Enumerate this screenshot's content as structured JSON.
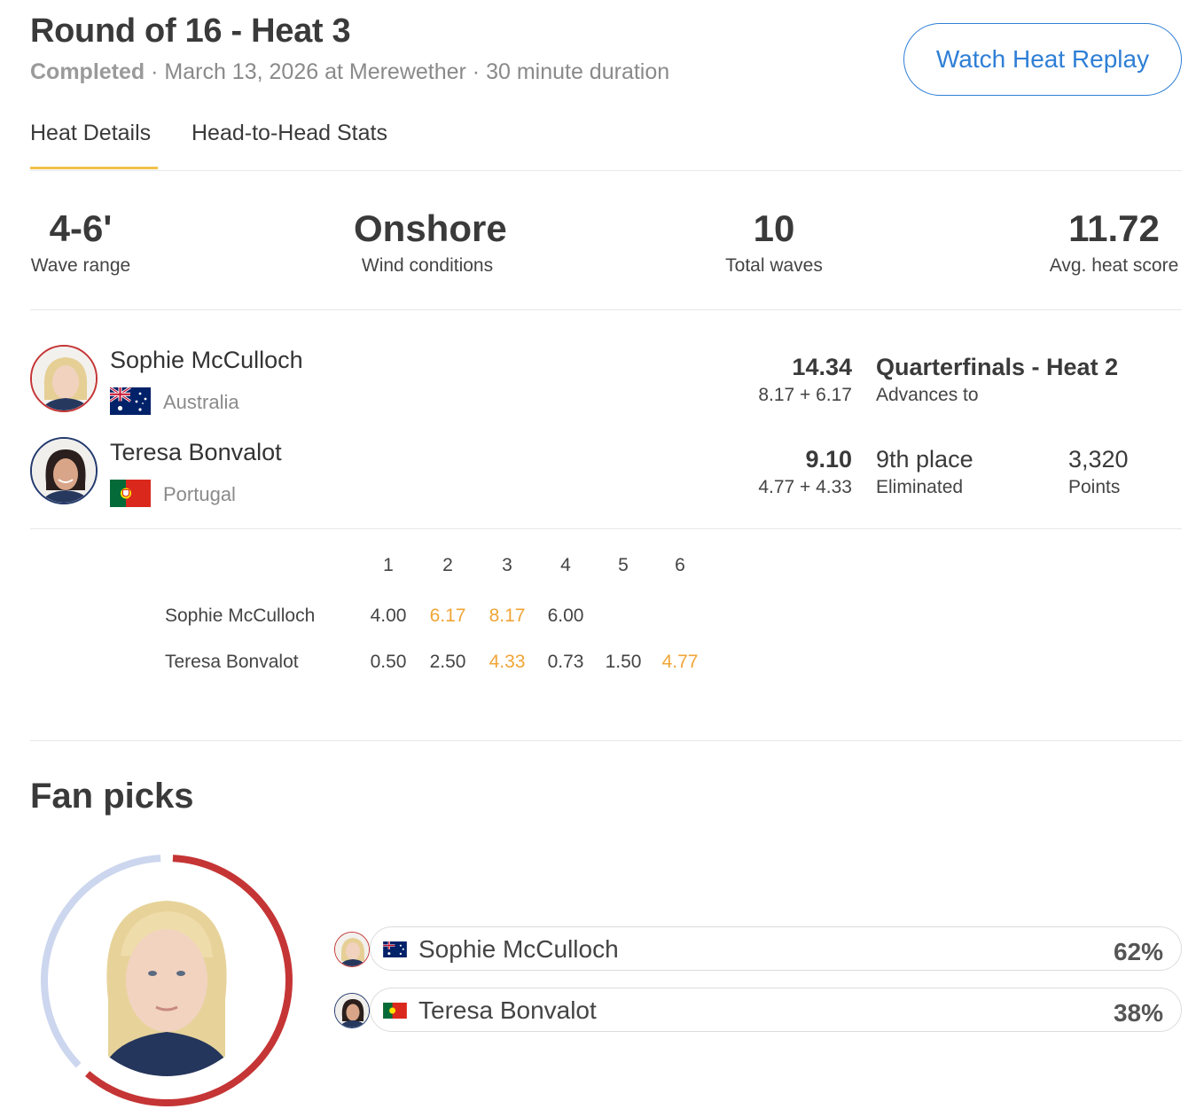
{
  "heat": {
    "title": "Round of 16 - Heat 3",
    "status": "Completed",
    "details": " · March 13, 2026 at Merewether · 30 minute duration",
    "replay_label": "Watch Heat Replay"
  },
  "tabs": [
    {
      "label": "Heat Details",
      "active": true
    },
    {
      "label": "Head-to-Head Stats",
      "active": false
    }
  ],
  "stats": [
    {
      "value": "4-6'",
      "label": "Wave range"
    },
    {
      "value": "Onshore",
      "label": "Wind conditions"
    },
    {
      "value": "10",
      "label": "Total waves"
    },
    {
      "value": "11.72",
      "label": "Avg. heat score"
    }
  ],
  "competitors": [
    {
      "name": "Sophie McCulloch",
      "country": "Australia",
      "flag_icon": "australia-flag-icon",
      "total": "14.34",
      "breakdown": "8.17 + 6.17",
      "result": "Quarterfinals - Heat 2",
      "result_sub": "Advances to"
    },
    {
      "name": "Teresa Bonvalot",
      "country": "Portugal",
      "flag_icon": "portugal-flag-icon",
      "total": "9.10",
      "breakdown": "4.77 + 4.33",
      "result": "9th place",
      "result_sub": "Eliminated",
      "points": "3,320",
      "points_label": "Points"
    }
  ],
  "wave_table": {
    "headers": [
      "1",
      "2",
      "3",
      "4",
      "5",
      "6"
    ],
    "rows": [
      {
        "name": "Sophie McCulloch",
        "scores": [
          "4.00",
          "6.17",
          "8.17",
          "6.00"
        ],
        "counting": [
          false,
          true,
          true,
          false
        ]
      },
      {
        "name": "Teresa Bonvalot",
        "scores": [
          "0.50",
          "2.50",
          "4.33",
          "0.73",
          "1.50",
          "4.77"
        ],
        "counting": [
          false,
          false,
          true,
          false,
          false,
          true
        ]
      }
    ]
  },
  "fan_picks": {
    "title": "Fan picks",
    "picks": [
      {
        "name": "Sophie McCulloch",
        "percent": "62%",
        "share": 62
      },
      {
        "name": "Teresa Bonvalot",
        "percent": "38%",
        "share": 38
      }
    ]
  },
  "colors": {
    "accent_blue": "#2f7fd6",
    "tab_underline": "#f0c24a",
    "counting_wave": "#f0a537",
    "donut_leader": "#c53535",
    "donut_other": "#ccd6ee"
  }
}
